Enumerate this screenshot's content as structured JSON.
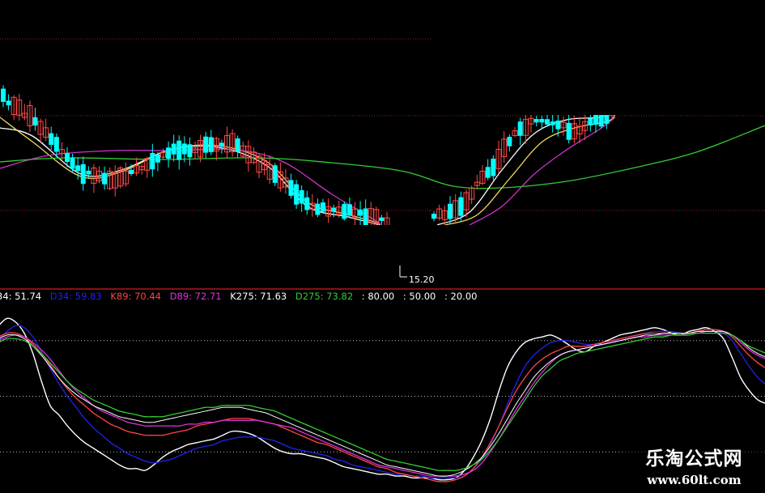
{
  "chart_data": [
    {
      "type": "candlestick",
      "panel": "price",
      "title": "",
      "xlabel": "",
      "ylabel": "",
      "tick_labels": [
        "15.20"
      ],
      "colors": {
        "up": "#ff4a4a",
        "down": "#00ffff"
      },
      "moving_averages": [
        {
          "color": "#ffffff"
        },
        {
          "color": "#f2d660"
        },
        {
          "color": "#cc33cc"
        },
        {
          "color": "#33cc33"
        }
      ]
    },
    {
      "type": "line",
      "panel": "indicator",
      "title": "",
      "xlabel": "",
      "ylabel": "",
      "ylim": [
        0,
        100
      ],
      "reference_levels": [
        80,
        50,
        20
      ],
      "legend": [
        {
          "text": "34: 51.74",
          "color": "#ffffff"
        },
        {
          "text": "D34: 59.83",
          "color": "#2222ee"
        },
        {
          "text": "K89: 70.44",
          "color": "#ff4444"
        },
        {
          "text": "D89: 72.71",
          "color": "#dd33dd"
        },
        {
          "text": "K275: 71.63",
          "color": "#ffffff"
        },
        {
          "text": "D275: 73.82",
          "color": "#33cc33"
        },
        {
          "text": ": 80.00",
          "color": "#ffffff"
        },
        {
          "text": ": 50.00",
          "color": "#ffffff"
        },
        {
          "text": ": 20.00",
          "color": "#ffffff"
        }
      ],
      "series": [
        {
          "color": "#ffffff",
          "width": 1.4,
          "values": [
            88,
            92,
            90,
            84,
            73,
            58,
            45,
            40,
            34,
            29,
            25,
            22,
            19,
            16,
            13,
            11,
            11,
            10,
            13,
            17,
            20,
            22,
            24,
            25,
            26,
            27,
            29,
            31,
            31,
            30,
            28,
            25,
            22,
            20,
            19,
            19,
            18,
            17,
            16,
            14,
            12,
            11,
            10,
            9,
            8,
            8,
            7,
            7,
            6,
            6,
            6,
            5,
            5,
            6,
            10,
            17,
            26,
            38,
            53,
            66,
            74,
            79,
            81,
            82,
            83,
            81,
            78,
            75,
            74,
            77,
            79,
            81,
            83,
            84,
            85,
            86,
            87,
            86,
            84,
            83,
            85,
            86,
            87,
            85,
            81,
            71,
            60,
            53,
            48,
            46
          ]
        },
        {
          "color": "#2222ee",
          "width": 1.3,
          "values": [
            80,
            85,
            88,
            87,
            82,
            74,
            65,
            57,
            50,
            44,
            38,
            33,
            29,
            25,
            22,
            19,
            17,
            15,
            14,
            15,
            16,
            18,
            20,
            22,
            23,
            24,
            26,
            27,
            28,
            28,
            28,
            27,
            26,
            24,
            22,
            21,
            20,
            19,
            18,
            16,
            15,
            13,
            12,
            11,
            10,
            9,
            8,
            8,
            7,
            7,
            6,
            6,
            6,
            6,
            7,
            11,
            16,
            24,
            34,
            46,
            57,
            66,
            72,
            76,
            79,
            80,
            80,
            79,
            78,
            78,
            78,
            79,
            81,
            82,
            83,
            84,
            85,
            85,
            85,
            84,
            84,
            85,
            85,
            85,
            84,
            80,
            73,
            66,
            60,
            56
          ]
        },
        {
          "color": "#ff4444",
          "width": 1.3,
          "values": [
            82,
            84,
            84,
            82,
            78,
            73,
            67,
            60,
            54,
            49,
            45,
            41,
            38,
            35,
            33,
            31,
            30,
            29,
            29,
            29,
            30,
            31,
            32,
            34,
            35,
            36,
            37,
            38,
            38,
            38,
            37,
            36,
            35,
            33,
            31,
            29,
            27,
            25,
            24,
            22,
            20,
            18,
            16,
            14,
            12,
            11,
            9,
            8,
            7,
            6,
            5,
            4,
            4,
            5,
            7,
            11,
            17,
            25,
            34,
            44,
            53,
            60,
            66,
            70,
            73,
            75,
            77,
            77,
            77,
            78,
            79,
            80,
            81,
            82,
            83,
            84,
            84,
            84,
            84,
            84,
            84,
            85,
            86,
            86,
            85,
            82,
            77,
            72,
            68,
            65
          ]
        },
        {
          "color": "#dd33dd",
          "width": 1.3,
          "values": [
            80,
            82,
            83,
            82,
            79,
            75,
            70,
            64,
            58,
            53,
            49,
            45,
            42,
            40,
            38,
            36,
            35,
            34,
            34,
            34,
            34,
            34,
            35,
            35,
            36,
            36,
            37,
            37,
            37,
            37,
            37,
            36,
            35,
            34,
            33,
            31,
            29,
            27,
            25,
            23,
            21,
            19,
            17,
            15,
            13,
            12,
            11,
            10,
            9,
            8,
            7,
            7,
            7,
            7,
            8,
            10,
            14,
            20,
            27,
            35,
            43,
            50,
            57,
            63,
            68,
            72,
            74,
            75,
            76,
            77,
            78,
            79,
            80,
            81,
            82,
            82,
            83,
            83,
            83,
            83,
            84,
            84,
            85,
            85,
            85,
            83,
            79,
            75,
            72,
            70
          ]
        },
        {
          "color": "#ffffff",
          "width": 1.0,
          "values": [
            81,
            83,
            83,
            81,
            77,
            72,
            66,
            60,
            55,
            51,
            48,
            45,
            43,
            41,
            39,
            38,
            37,
            36,
            36,
            37,
            38,
            39,
            40,
            41,
            42,
            43,
            44,
            44,
            44,
            43,
            42,
            41,
            39,
            37,
            35,
            33,
            31,
            29,
            27,
            25,
            23,
            21,
            19,
            17,
            15,
            13,
            12,
            11,
            10,
            9,
            8,
            7,
            7,
            8,
            10,
            13,
            17,
            23,
            30,
            38,
            46,
            53,
            60,
            65,
            69,
            72,
            74,
            75,
            76,
            77,
            78,
            79,
            80,
            81,
            82,
            83,
            83,
            84,
            84,
            84,
            84,
            85,
            85,
            85,
            85,
            83,
            80,
            76,
            73,
            71
          ]
        },
        {
          "color": "#33cc33",
          "width": 1.3,
          "values": [
            79,
            81,
            81,
            80,
            77,
            73,
            68,
            63,
            58,
            54,
            51,
            48,
            46,
            44,
            42,
            41,
            40,
            39,
            39,
            39,
            40,
            41,
            42,
            43,
            44,
            44,
            45,
            45,
            45,
            45,
            44,
            43,
            42,
            40,
            38,
            36,
            34,
            32,
            30,
            28,
            26,
            24,
            22,
            20,
            18,
            16,
            15,
            14,
            13,
            12,
            11,
            10,
            10,
            10,
            11,
            13,
            16,
            21,
            27,
            34,
            41,
            48,
            55,
            61,
            65,
            69,
            71,
            73,
            74,
            75,
            76,
            77,
            78,
            79,
            80,
            81,
            82,
            82,
            83,
            83,
            83,
            84,
            84,
            84,
            84,
            83,
            80,
            77,
            75,
            73
          ]
        }
      ]
    }
  ],
  "watermark": {
    "title": "乐淘公式网",
    "url": "www.60lt.com"
  }
}
